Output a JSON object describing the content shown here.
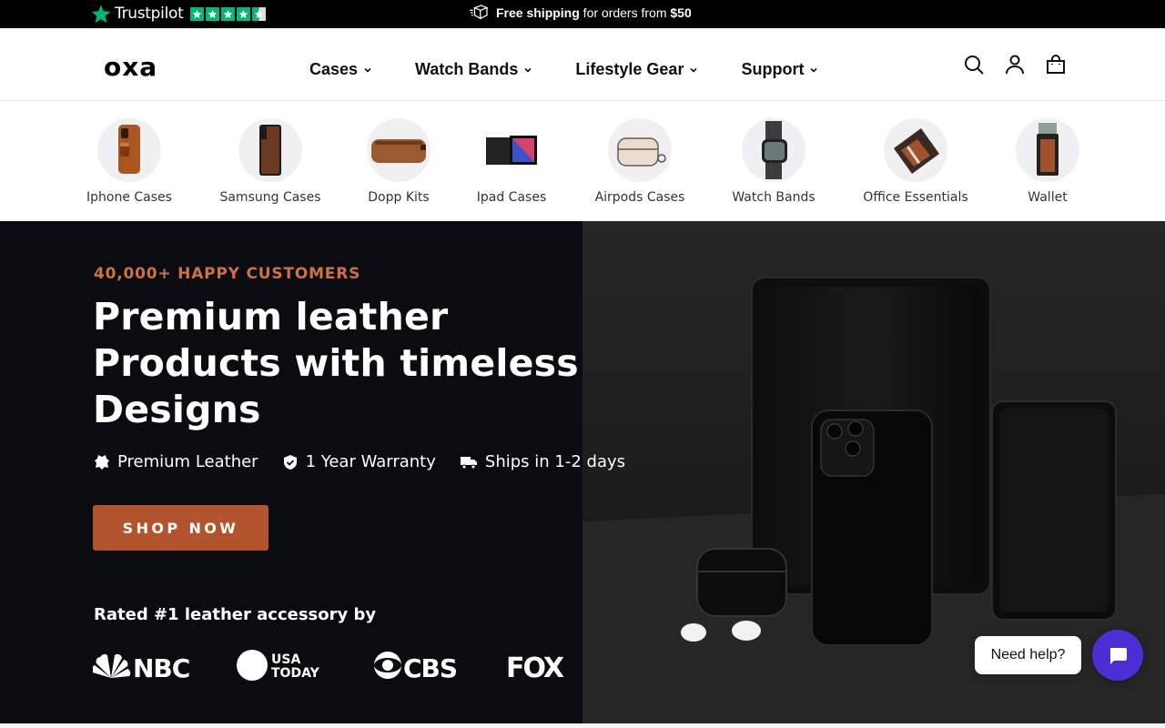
{
  "topbar": {
    "trustpilot_label": "Trustpilot",
    "rating_stars": 4.5,
    "shipping_prefix": "Free shipping",
    "shipping_middle": " for orders from ",
    "shipping_amount": "$50"
  },
  "header": {
    "logo": "oxa",
    "nav": [
      {
        "label": "Cases"
      },
      {
        "label": "Watch Bands"
      },
      {
        "label": "Lifestyle Gear"
      },
      {
        "label": "Support"
      }
    ],
    "icons": [
      "search-icon",
      "account-icon",
      "cart-icon"
    ]
  },
  "categories": [
    {
      "label": "Iphone Cases"
    },
    {
      "label": "Samsung Cases"
    },
    {
      "label": "Dopp Kits"
    },
    {
      "label": "Ipad Cases"
    },
    {
      "label": "Airpods Cases"
    },
    {
      "label": "Watch Bands"
    },
    {
      "label": "Office Essentials"
    },
    {
      "label": "Wallet"
    }
  ],
  "hero": {
    "eyebrow": "40,000+ HAPPY CUSTOMERS",
    "headline": "Premium leather Products with timeless Designs",
    "features": [
      {
        "label": "Premium Leather",
        "icon": "leather-icon"
      },
      {
        "label": "1 Year Warranty",
        "icon": "shield-check-icon"
      },
      {
        "label": "Ships in 1-2 days",
        "icon": "truck-icon"
      }
    ],
    "cta": "SHOP NOW",
    "rated": "Rated #1 leather accessory by",
    "press": [
      "NBC",
      "USA TODAY",
      "CBS",
      "FOX"
    ]
  },
  "chat": {
    "bubble": "Need help?"
  },
  "colors": {
    "accent": "#b2552f",
    "eyebrow": "#d0723e",
    "hero_bg": "#0b0c11",
    "trustpilot_green": "#00b67a",
    "chat": "#4b2fd4"
  }
}
